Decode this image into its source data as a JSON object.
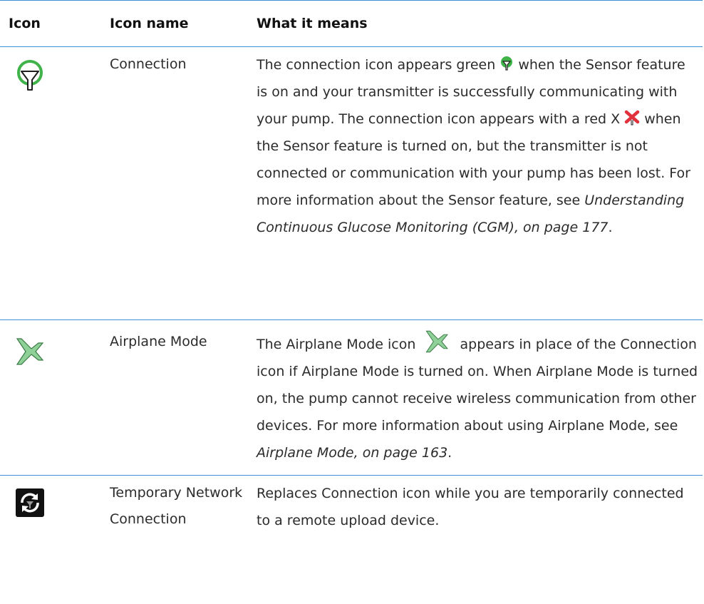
{
  "header": {
    "icon": "Icon",
    "icon_name": "Icon name",
    "meaning": "What it means"
  },
  "rows": [
    {
      "icon": "connection-icon",
      "name": "Connection",
      "meaning_parts": [
        "The connection icon appears green ",
        " when the Sensor feature is on and your transmitter is successfully communicating with your pump. The connection icon appears with a red X ",
        " when the Sensor feature is turned on, but the transmitter is not connected or communication with your pump has been lost. For more information about the Sensor feature, see ",
        "Understanding Continuous Glucose Monitoring (CGM), on page 177",
        "."
      ]
    },
    {
      "icon": "airplane-icon",
      "name": "Airplane Mode",
      "meaning_parts": [
        "The Airplane Mode icon ",
        " appears in place of the Connection icon if Airplane Mode is turned on. When Airplane Mode is turned on, the pump cannot receive wireless communication from other devices. For more information about using Airplane Mode, see ",
        "Airplane Mode, on page 163",
        "."
      ]
    },
    {
      "icon": "temporary-network-icon",
      "name": "Temporary Network Connection",
      "meaning": "Replaces Connection icon while you are temporarily connected to a remote upload device."
    }
  ],
  "colors": {
    "rule": "#3d8fd6",
    "connection_green": "#3fb34a",
    "error_red": "#e0313d",
    "airplane_green": "#7fc98a"
  }
}
